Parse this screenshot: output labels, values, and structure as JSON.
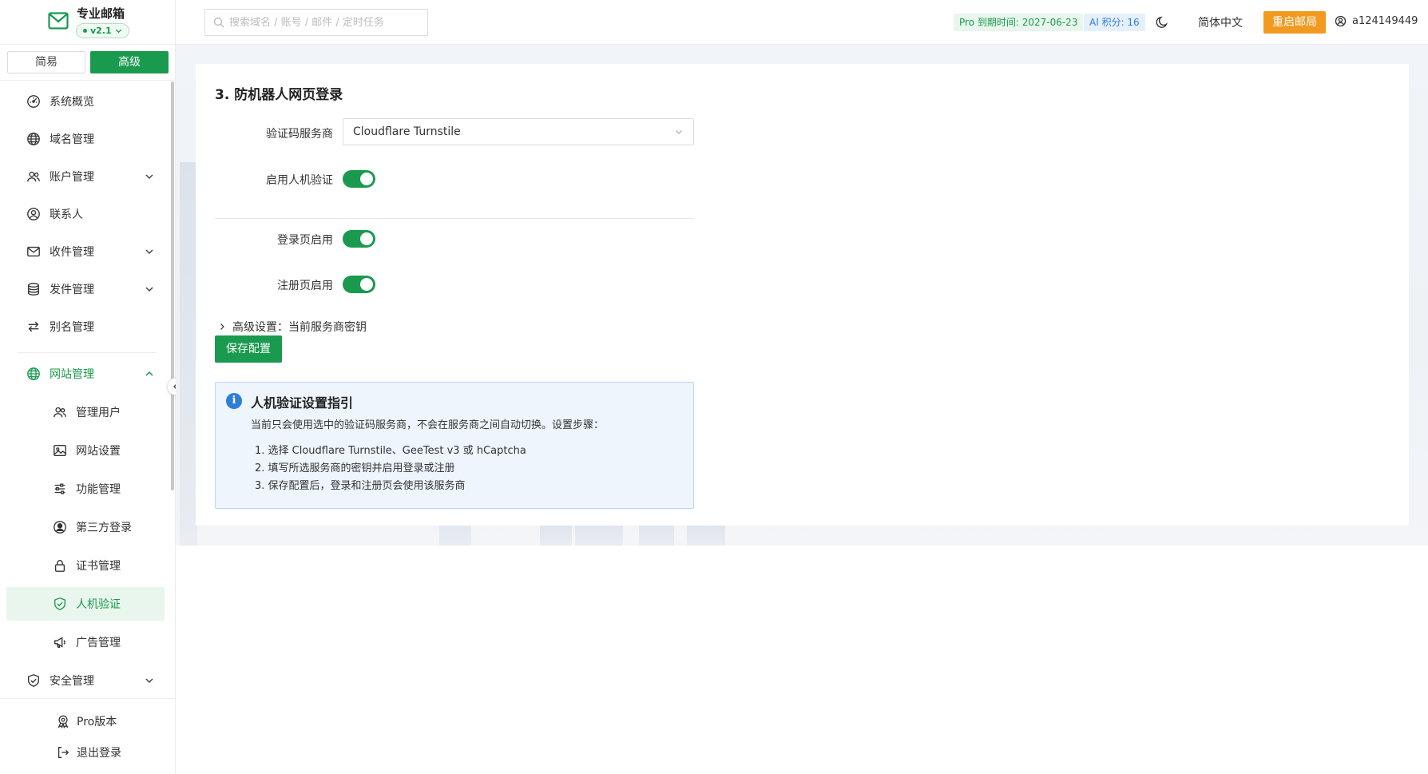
{
  "brand": {
    "title": "专业邮箱",
    "version": "v2.1"
  },
  "mode_tabs": {
    "simple": "简易",
    "advanced": "高级"
  },
  "nav": {
    "overview": "系统概览",
    "domains": "域名管理",
    "accounts": "账户管理",
    "contacts": "联系人",
    "inbox": "收件管理",
    "outbox": "发件管理",
    "alias": "别名管理",
    "website": "网站管理",
    "website_children": {
      "users": "管理用户",
      "settings": "网站设置",
      "features": "功能管理",
      "oauth": "第三方登录",
      "certs": "证书管理",
      "captcha": "人机验证",
      "ads": "广告管理"
    },
    "security": "安全管理"
  },
  "bottom": {
    "pro": "Pro版本",
    "logout": "退出登录"
  },
  "header": {
    "search_placeholder": "搜索域名 / 账号 / 邮件 / 定时任务",
    "pro_tag": "Pro 到期时间: 2027-06-23",
    "ai_tag": "AI 积分: 16",
    "language": "简体中文",
    "restart_button": "重启邮局",
    "username": "a124149449"
  },
  "form": {
    "section_title": "3. 防机器人网页登录",
    "provider_label": "验证码服务商",
    "provider_value": "Cloudflare Turnstile",
    "enable_label": "启用人机验证",
    "login_label": "登录页启用",
    "register_label": "注册页启用",
    "advanced_label": "高级设置：当前服务商密钥",
    "save_button": "保存配置",
    "switches": {
      "enable": true,
      "login": true,
      "register": true
    }
  },
  "guide": {
    "title": "人机验证设置指引",
    "description": "当前只会使用选中的验证码服务商，不会在服务商之间自动切换。设置步骤：",
    "steps": [
      "1. 选择 Cloudflare Turnstile、GeeTest v3 或 hCaptcha",
      "2. 填写所选服务商的密钥并启用登录或注册",
      "3. 保存配置后，登录和注册页会使用该服务商"
    ]
  },
  "colors": {
    "primary": "#1a9a4e",
    "warning": "#f29a1f",
    "info": "#2f7dd8"
  }
}
